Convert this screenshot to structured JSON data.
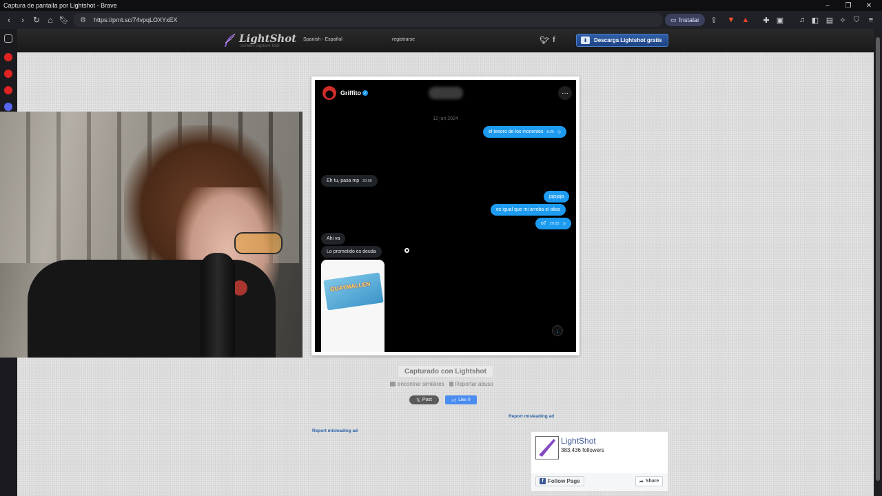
{
  "window": {
    "title": "Captura de pantalla por Lightshot - Brave"
  },
  "browser": {
    "url": "https://prnt.sc/74vpqLOXYxEX",
    "install_label": "Instalar"
  },
  "site": {
    "logo_name": "LightShot",
    "logo_tagline": "screen capture tool",
    "language": "Spanish - Español",
    "register": "registrarse",
    "download_label": "Descarga Lightshot gratis"
  },
  "chat": {
    "user": "Griffito",
    "date": "12 jun 2024",
    "messages": [
      {
        "dir": "out",
        "text": "el tesoro de los inocentes",
        "time": "8:25"
      },
      {
        "dir": "in",
        "text": "Eh tu, pasa mp",
        "time": "20:06"
      },
      {
        "dir": "out",
        "text": "jajsjaja",
        "time": ""
      },
      {
        "dir": "out",
        "text": "es igual que mi arroba el alias",
        "time": ""
      },
      {
        "dir": "out",
        "text": "o7",
        "time": "20:25"
      },
      {
        "dir": "in",
        "text": "Ahi va",
        "time": ""
      },
      {
        "dir": "in",
        "text": "Lo prometido es deuda",
        "time": ""
      }
    ],
    "image_brand": "GUAYMALLEN"
  },
  "captured_label": "Capturado con Lightshot",
  "find_similar": "encontrar similares",
  "report_abuse": "Reportar abuso",
  "x_post": "Post",
  "fb_like": "Like 0",
  "report_ad_1": "Report misleading ad",
  "report_ad_2": "Report misleading ad",
  "fb_widget": {
    "title": "LightShot",
    "followers": "383,436 followers",
    "follow": "Follow Page",
    "share": "Share"
  }
}
